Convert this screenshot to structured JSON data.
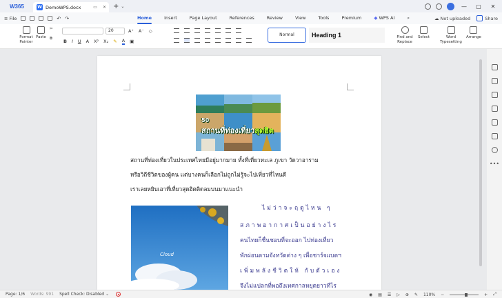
{
  "titlebar": {
    "logo": "W365",
    "doc_tab": "DemoWPS.docx",
    "new_tab": "+"
  },
  "menu": {
    "file": "File",
    "tabs": [
      "Home",
      "Insert",
      "Page Layout",
      "References",
      "Review",
      "View",
      "Tools",
      "Premium",
      "WPS AI"
    ],
    "active_tab": "Home",
    "not_uploaded": "Not uploaded",
    "share": "Share"
  },
  "ribbon": {
    "format_painter": "Format Painter",
    "paste": "Paste",
    "font_size": "20",
    "style_normal": "Normal",
    "style_heading": "Heading 1",
    "find_replace": "Find and Replace",
    "select": "Select",
    "word_typesetting": "Word Typesetting",
    "arrange": "Arrange"
  },
  "document": {
    "banner_num": "50",
    "banner_line1": "สถานที่ท่องเที่ยว",
    "banner_line2": "สุดฮิต",
    "paragraph": [
      "สถานที่ท่องเที่ยวในประเทศไทยมีอยู่มากมาย ทั้งที่เที่ยวทะเล ภูเขา วัดวาอาราม",
      "หรือวิถีชีวิตของผู้คน แต่บางคนก็เลือกไม่ถูกไม่รู้จะไปเที่ยวที่ไหนดี",
      "เราเลยหยิบเอาที่เที่ยวสุดฮิตติดลมบนมาแนะนำ"
    ],
    "photo_caption": "Cloud",
    "poem": [
      "ไม่ว่าจะฤดูไหน ๆ",
      "สภาพอากาศเป็นอย่างไร",
      "คนไทยก็ชื่นชอบที่จะออก ไปท่องเที่ยว",
      "พักผ่อนตามจังหวัดต่าง ๆ เพื่อชาร์จแบตฯ",
      "เพิ่มพลังชีวิตให้ กับตัวเอง",
      "จึงไม่แปลกที่พอถึงเทศกาลหยุดยาวทีไร"
    ]
  },
  "status": {
    "page": "Page: 1/6",
    "words": "Words: 991",
    "spell": "Spell Check: Disabled",
    "zoom": "110%"
  }
}
